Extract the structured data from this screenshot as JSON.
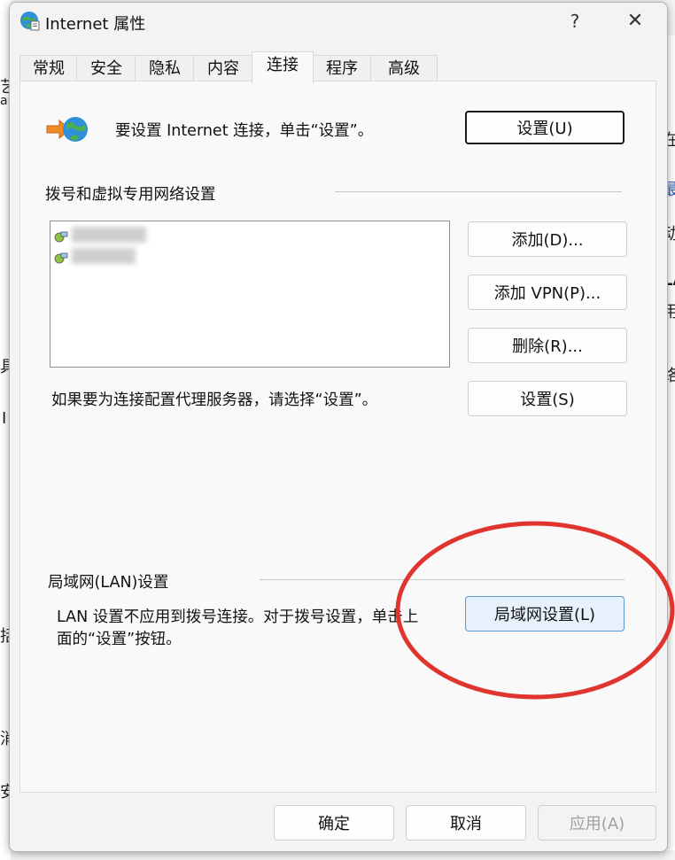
{
  "background": {
    "fragments": [
      "艺",
      "ar",
      "在",
      "最",
      "动",
      "LA",
      "用",
      "具",
      "I",
      "络",
      "括",
      "消",
      "安"
    ]
  },
  "dialog": {
    "title": "Internet 属性",
    "help_label": "?",
    "close_label": "✕",
    "tabs": [
      "常规",
      "安全",
      "隐私",
      "内容",
      "连接",
      "程序",
      "高级"
    ],
    "active_tab": "连接"
  },
  "setup": {
    "text": "要设置 Internet 连接，单击“设置”。",
    "button_label": "设置(U)"
  },
  "dialup": {
    "group_title": "拨号和虚拟专用网络设置",
    "add_button": "添加(D)...",
    "add_vpn_button": "添加 VPN(P)...",
    "remove_button": "删除(R)...",
    "proxy_text": "如果要为连接配置代理服务器，请选择“设置”。",
    "settings_button": "设置(S)"
  },
  "lan": {
    "group_title": "局域网(LAN)设置",
    "text_line1": "LAN 设置不应用到拨号连接。对于拨号设置，单击上",
    "text_line2": "面的“设置”按钮。",
    "button_label": "局域网设置(L)"
  },
  "footer": {
    "ok_button": "确定",
    "cancel_button": "取消",
    "apply_button": "应用(A)"
  },
  "annotation": {
    "ellipse_color": "#e0342e"
  }
}
